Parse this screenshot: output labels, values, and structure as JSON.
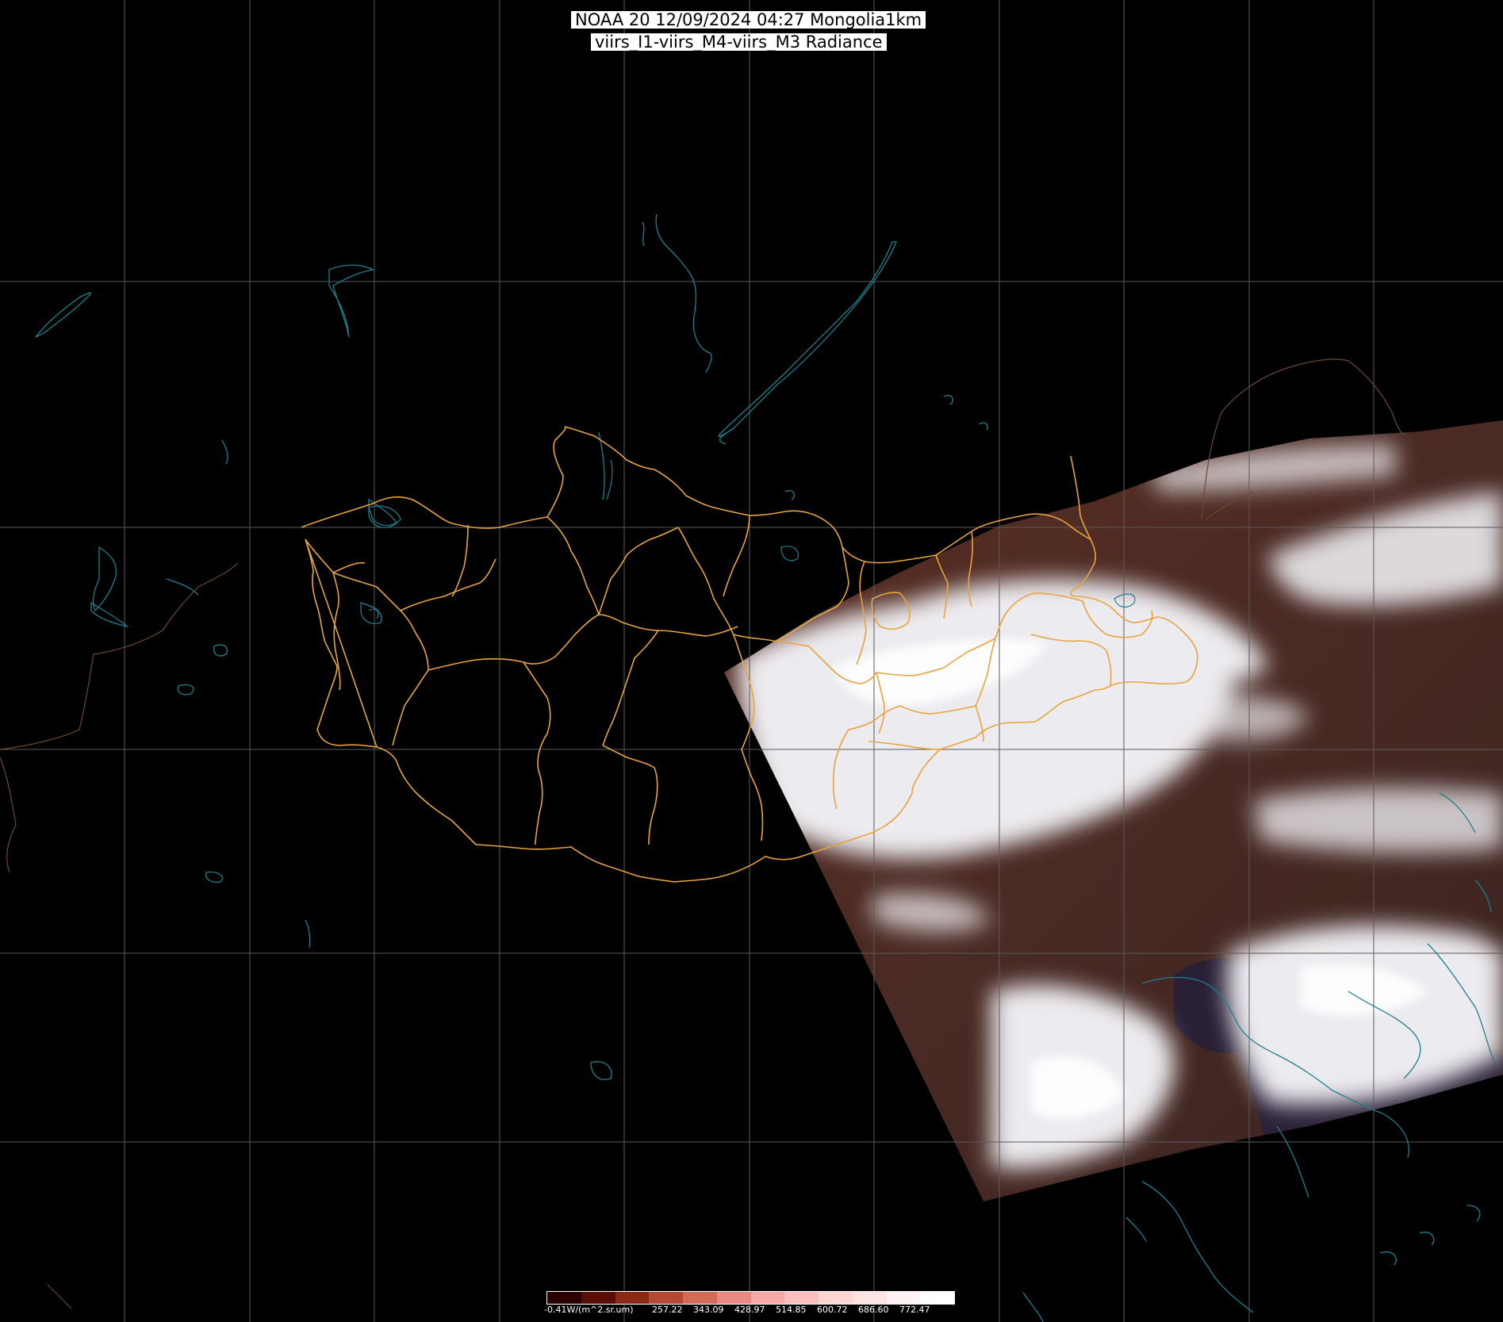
{
  "header": {
    "title_line1": "NOAA 20 12/09/2024 04:27 Mongolia1km",
    "title_line2": "viirs_I1-viirs_M4-viirs_M3 Radiance"
  },
  "colorbar": {
    "unit_label": "-0.41W/(m^2.sr.um)",
    "tick_labels": [
      "257.22",
      "343.09",
      "428.97",
      "514.85",
      "600.72",
      "686.60",
      "772.47"
    ],
    "colors": [
      "#2a0000",
      "#5a0e06",
      "#8a2a16",
      "#b54a34",
      "#d46a58",
      "#e88a82",
      "#f5a8a6",
      "#fac0be",
      "#fcd4d2",
      "#fde4e2",
      "#fff2f2",
      "#ffffff"
    ]
  },
  "map": {
    "grid_color": "#5a5a5a",
    "coastline_color": "#1f7f8f",
    "border_color": "#e7a43f",
    "land_color": "#4a2a22",
    "cloud_color": "#e8e6ea"
  }
}
